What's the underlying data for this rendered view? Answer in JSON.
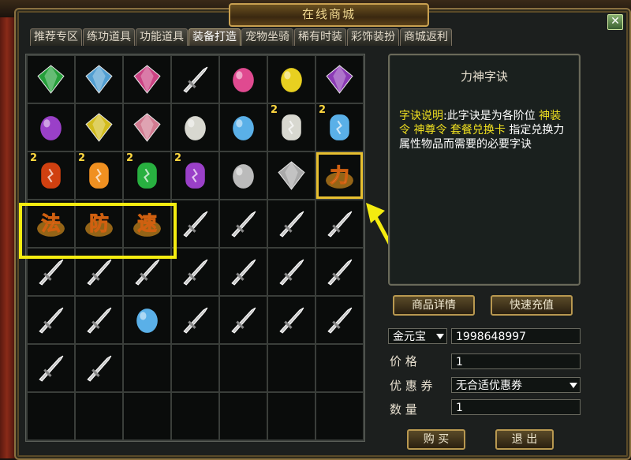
{
  "window": {
    "title": "在线商城",
    "close_glyph": "✕"
  },
  "tabs": [
    {
      "label": "推荐专区",
      "active": false
    },
    {
      "label": "练功道具",
      "active": false
    },
    {
      "label": "功能道具",
      "active": false
    },
    {
      "label": "装备打造",
      "active": true
    },
    {
      "label": "宠物坐骑",
      "active": false
    },
    {
      "label": "稀有时装",
      "active": false
    },
    {
      "label": "彩饰装扮",
      "active": false
    },
    {
      "label": "商城返利",
      "active": false
    }
  ],
  "items": [
    {
      "icon": "green-gem-icon",
      "count": ""
    },
    {
      "icon": "blue-diamond-icon",
      "count": ""
    },
    {
      "icon": "pink-diamond-icon",
      "count": ""
    },
    {
      "icon": "silver-gem-icon",
      "count": ""
    },
    {
      "icon": "pink-egg-gem-icon",
      "count": ""
    },
    {
      "icon": "yellow-egg-gem-icon",
      "count": ""
    },
    {
      "icon": "purple-crystal-icon",
      "count": ""
    },
    {
      "icon": "purple-orb-icon",
      "count": ""
    },
    {
      "icon": "gold-crystal-icon",
      "count": ""
    },
    {
      "icon": "rose-crystal-icon",
      "count": ""
    },
    {
      "icon": "pearl-icon",
      "count": ""
    },
    {
      "icon": "blue-orb-stand-icon",
      "count": ""
    },
    {
      "icon": "white-rune-stone-icon",
      "count": "2"
    },
    {
      "icon": "blue-rune-stone-icon",
      "count": "2"
    },
    {
      "icon": "red-rune-stone-icon",
      "count": "2"
    },
    {
      "icon": "orange-rune-stone-icon",
      "count": "2"
    },
    {
      "icon": "green-rune-stone-icon",
      "count": "2"
    },
    {
      "icon": "purple-rune-stone-icon",
      "count": "2"
    },
    {
      "icon": "ring-orb-icon",
      "count": ""
    },
    {
      "icon": "gem-pile-icon",
      "count": ""
    },
    {
      "icon": "li-rune-icon",
      "count": "",
      "selected": true,
      "glyph": "力"
    },
    {
      "icon": "fa-rune-icon",
      "count": "",
      "glyph": "法"
    },
    {
      "icon": "fang-rune-icon",
      "count": "",
      "glyph": "防"
    },
    {
      "icon": "su-rune-icon",
      "count": "",
      "glyph": "速"
    },
    {
      "icon": "silver-spear-icon",
      "count": ""
    },
    {
      "icon": "silver-blade-icon",
      "count": ""
    },
    {
      "icon": "silver-sword-icon",
      "count": ""
    },
    {
      "icon": "silver-claw-icon",
      "count": ""
    },
    {
      "icon": "silver-mace-icon",
      "count": ""
    },
    {
      "icon": "silver-bracelet-icon",
      "count": ""
    },
    {
      "icon": "silver-necklace-icon",
      "count": ""
    },
    {
      "icon": "silver-ornament-icon",
      "count": ""
    },
    {
      "icon": "silver-feather-blade-icon",
      "count": ""
    },
    {
      "icon": "silver-armor-plate-icon",
      "count": ""
    },
    {
      "icon": "silver-staff-icon",
      "count": ""
    },
    {
      "icon": "silver-bow-icon",
      "count": ""
    },
    {
      "icon": "silver-axe-icon",
      "count": ""
    },
    {
      "icon": "blue-magic-orb-icon",
      "count": ""
    },
    {
      "icon": "silver-amulet-icon",
      "count": ""
    },
    {
      "icon": "silver-wings-icon",
      "count": ""
    },
    {
      "icon": "silver-helmet-icon",
      "count": ""
    },
    {
      "icon": "silver-chestplate-icon",
      "count": ""
    },
    {
      "icon": "silver-gloves-icon",
      "count": ""
    },
    {
      "icon": "silver-boots-icon",
      "count": ""
    },
    {
      "icon": "",
      "count": ""
    },
    {
      "icon": "",
      "count": ""
    },
    {
      "icon": "",
      "count": ""
    },
    {
      "icon": "",
      "count": ""
    },
    {
      "icon": "",
      "count": ""
    },
    {
      "icon": "",
      "count": ""
    },
    {
      "icon": "",
      "count": ""
    },
    {
      "icon": "",
      "count": ""
    },
    {
      "icon": "",
      "count": ""
    },
    {
      "icon": "",
      "count": ""
    },
    {
      "icon": "",
      "count": ""
    },
    {
      "icon": "",
      "count": ""
    }
  ],
  "detail": {
    "name": "力神字诀",
    "desc_label": "字诀说明",
    "desc_sep": ":",
    "desc_part1": "此字诀是为各阶位",
    "desc_highlight": "神装令 神尊令 套餐兑换卡",
    "desc_part2": "指定兑换力属性物品而需要的必要字诀"
  },
  "buttons": {
    "details": "商品详情",
    "recharge": "快速充值",
    "buy": "购 买",
    "exit": "退 出"
  },
  "form": {
    "currency_select": "金元宝",
    "balance": "1998648997",
    "price_label": "价    格",
    "price_value": "1",
    "coupon_label": "优 惠 券",
    "coupon_value": "无合适优惠券",
    "qty_label": "数    量",
    "qty_value": "1"
  },
  "colors": {
    "accent_yellow": "#f4ec10",
    "frame_gold": "#b89850"
  }
}
